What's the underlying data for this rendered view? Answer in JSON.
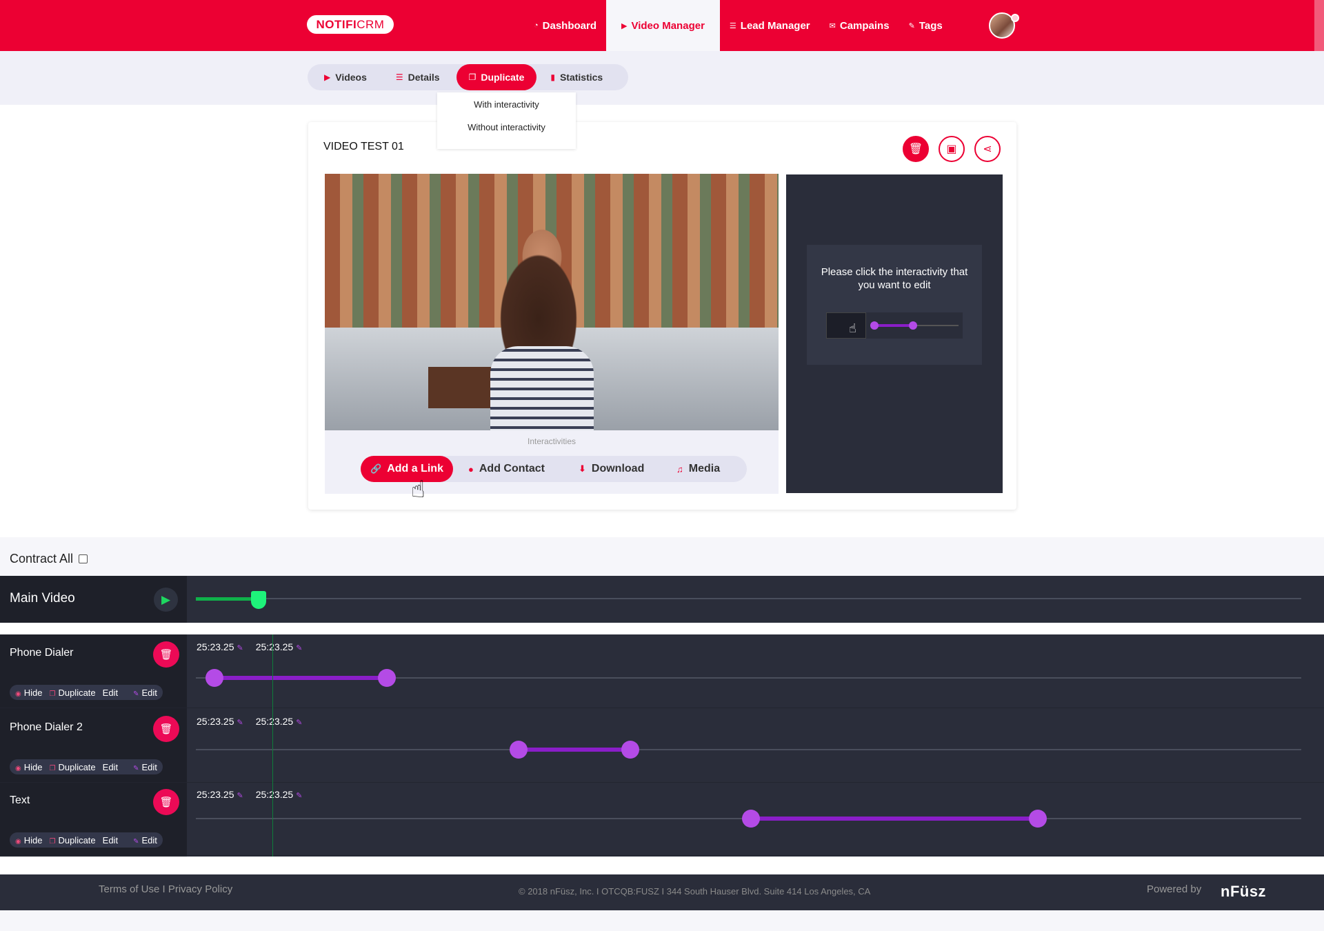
{
  "header": {
    "logo_bold": "NOTIFI",
    "logo_light": "CRM",
    "nav": [
      {
        "label": "Dashboard",
        "icon": "gauge-icon"
      },
      {
        "label": "Video Manager",
        "icon": "play-icon"
      },
      {
        "label": "Lead Manager",
        "icon": "list-icon"
      },
      {
        "label": "Campains",
        "icon": "mail-icon"
      },
      {
        "label": "Tags",
        "icon": "pencil-icon"
      }
    ]
  },
  "subtabs": [
    {
      "label": "Videos",
      "icon": "play-icon"
    },
    {
      "label": "Details",
      "icon": "list-icon"
    },
    {
      "label": "Duplicate",
      "icon": "copy-icon"
    },
    {
      "label": "Statistics",
      "icon": "bar-chart-icon"
    }
  ],
  "dropdown": {
    "items": [
      "With interactivity",
      "Without interactivity"
    ]
  },
  "card": {
    "title": "VIDEO TEST 01",
    "interactivities_label": "Interactivities",
    "interactivity_buttons": [
      {
        "label": "Add a Link",
        "icon": "link-icon"
      },
      {
        "label": "Add Contact",
        "icon": "user-icon"
      },
      {
        "label": "Download",
        "icon": "download-icon"
      },
      {
        "label": "Media",
        "icon": "music-icon"
      }
    ],
    "side_panel_text": "Please click the interactivity that you want to edit"
  },
  "timeline": {
    "contract_all_label": "Contract All",
    "main_video_label": "Main Video",
    "main_progress_fraction": 0.057,
    "rows": [
      {
        "name": "Phone Dialer",
        "start": "25:23.25",
        "end": "25:23.25",
        "seg_start": 0.017,
        "seg_end": 0.173
      },
      {
        "name": "Phone Dialer 2",
        "start": "25:23.25",
        "end": "25:23.25",
        "seg_start": 0.292,
        "seg_end": 0.393
      },
      {
        "name": "Text",
        "start": "25:23.25",
        "end": "25:23.25",
        "seg_start": 0.502,
        "seg_end": 0.762
      }
    ],
    "actions": {
      "hide": "Hide",
      "duplicate": "Duplicate",
      "duplicate_overlap": "Duplicate",
      "edit": "Edit",
      "edit2": "Edit"
    }
  },
  "footer": {
    "links": "Terms of Use I Privacy Policy",
    "copyright": "© 2018 nFüsz, Inc. I OTCQB:FUSZ I 344 South Hauser Blvd. Suite 414 Los Angeles, CA",
    "powered_by": "Powered by",
    "brand": "nFüsz"
  },
  "colors": {
    "brand": "#ec0033",
    "accent_purple": "#b44be6",
    "progress_green": "#0fb14a",
    "dark_panel": "#2a2d3a"
  }
}
